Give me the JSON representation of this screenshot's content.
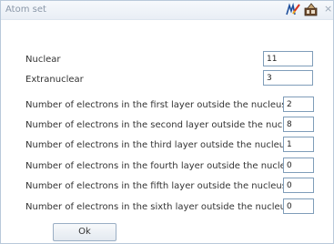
{
  "dialog": {
    "title": "Atom set",
    "icons": [
      "checkmark-pen-icon",
      "edit-box-icon",
      "close-icon"
    ],
    "close_glyph": "×"
  },
  "fields": [
    {
      "label": "Nuclear",
      "value": "11"
    },
    {
      "label": "Extranuclear",
      "value": "3"
    },
    {
      "label": "Number of electrons in the first layer outside the nucleus:",
      "value": "2"
    },
    {
      "label": "Number of electrons in the second layer outside the nucleus:",
      "value": "8"
    },
    {
      "label": "Number of electrons in the third layer outside the nucleus:",
      "value": "1"
    },
    {
      "label": "Number of electrons in the fourth layer outside the nucleus:",
      "value": "0"
    },
    {
      "label": "Number of electrons in the fifth layer outside the nucleus:",
      "value": "0"
    },
    {
      "label": "Number of electrons in the sixth layer outside the nucleus:",
      "value": "0"
    }
  ],
  "buttons": {
    "ok_label": "Ok"
  }
}
